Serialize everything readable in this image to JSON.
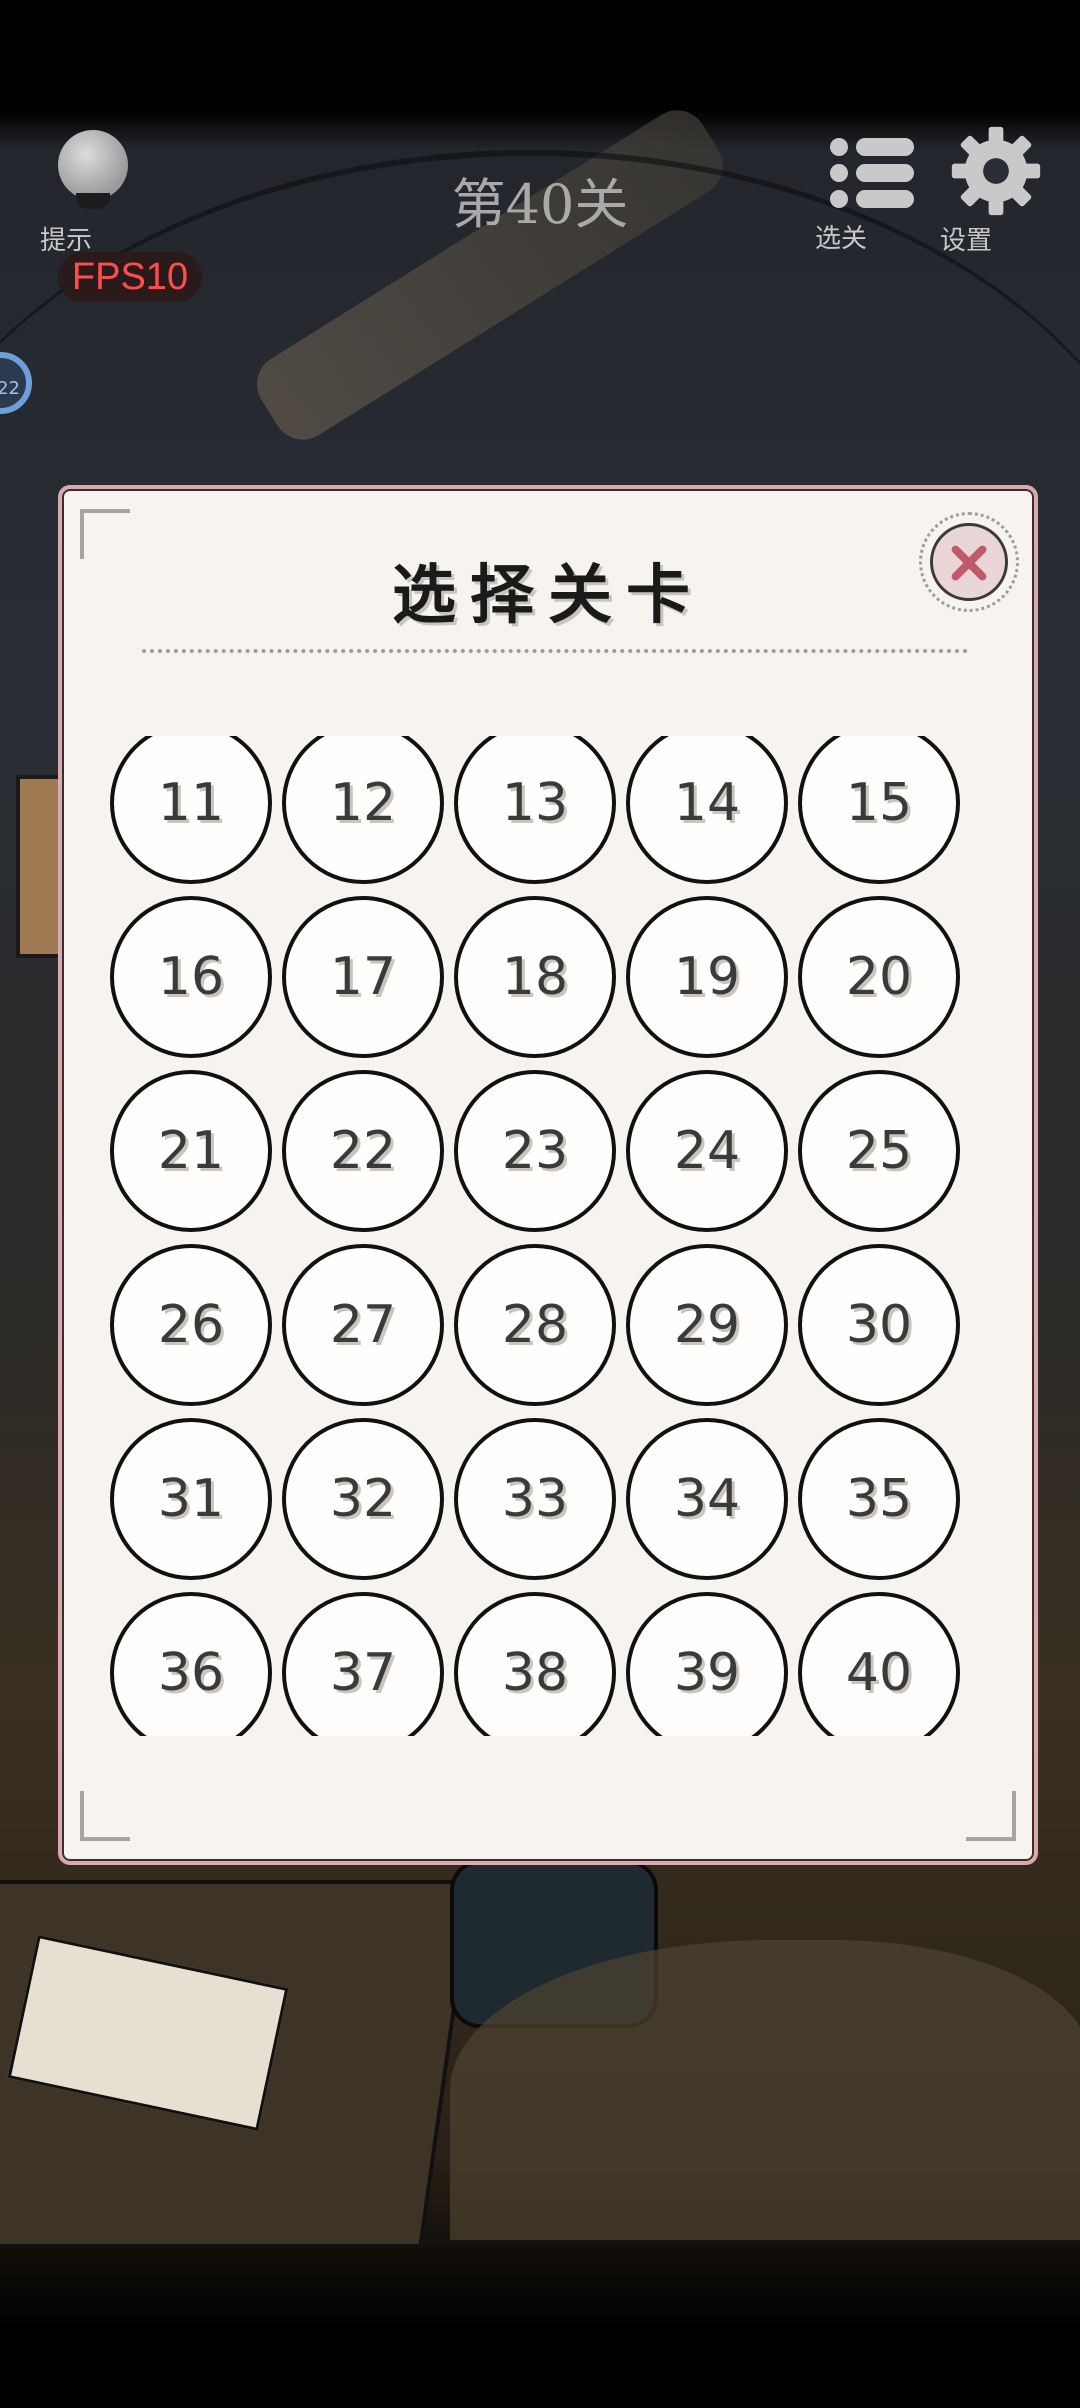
{
  "hud": {
    "hint_label": "提示",
    "fps_text": "FPS10",
    "level_title": "第40关",
    "select_label": "选关",
    "settings_label": "设置",
    "side_badge": "22"
  },
  "modal": {
    "title": "选择关卡",
    "levels": [
      "11",
      "12",
      "13",
      "14",
      "15",
      "16",
      "17",
      "18",
      "19",
      "20",
      "21",
      "22",
      "23",
      "24",
      "25",
      "26",
      "27",
      "28",
      "29",
      "30",
      "31",
      "32",
      "33",
      "34",
      "35",
      "36",
      "37",
      "38",
      "39",
      "40"
    ]
  },
  "colors": {
    "fps": "#ff4d4d",
    "modal_bg": "#f7f4ef",
    "modal_border": "#d9a9ad",
    "close_x": "#c05a68"
  }
}
